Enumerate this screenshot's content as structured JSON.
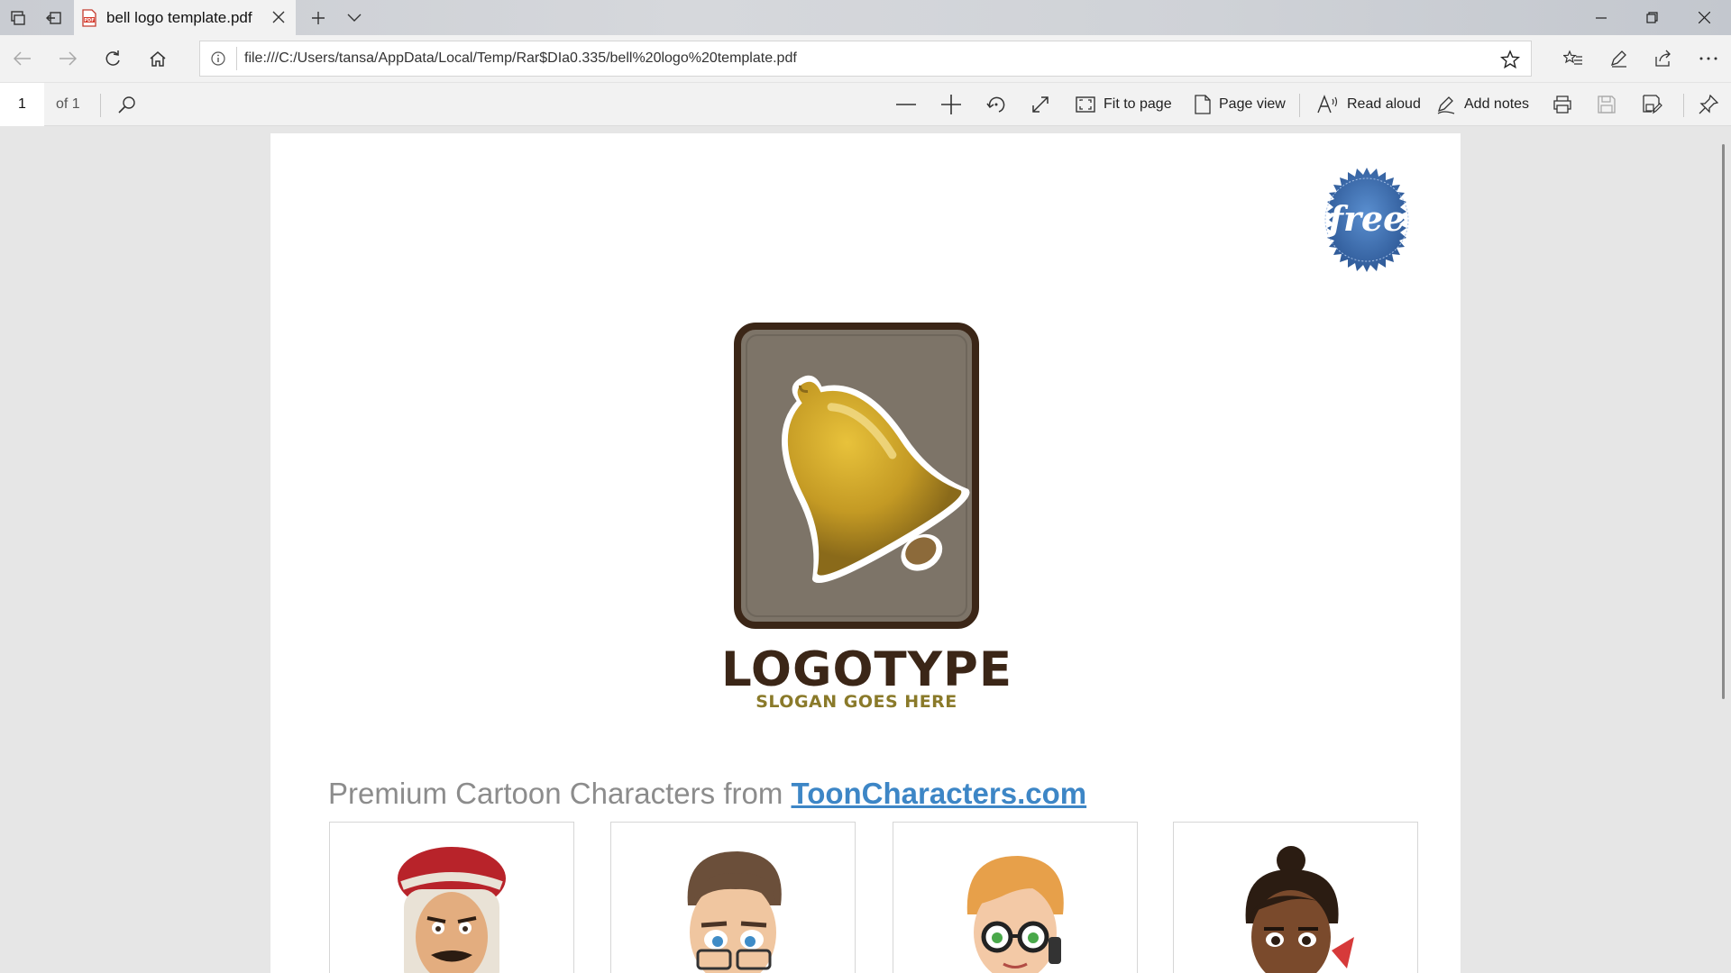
{
  "tab": {
    "title": "bell logo template.pdf",
    "pdf_badge": "PDF"
  },
  "address_bar": {
    "url": "file:///C:/Users/tansa/AppData/Local/Temp/Rar$DIa0.335/bell%20logo%20template.pdf"
  },
  "pdf_toolbar": {
    "page_number": "1",
    "page_total": "of 1",
    "fit_to_page": "Fit to page",
    "page_view": "Page view",
    "read_aloud": "Read aloud",
    "add_notes": "Add notes"
  },
  "document": {
    "badge_text": "free",
    "logotype": "LOGOTYPE",
    "slogan": "SLOGAN GOES HERE",
    "promo_text": "Premium Cartoon Characters from ",
    "promo_link": "ToonCharacters.com",
    "characters": [
      "arab-man-character",
      "glasses-man-character",
      "redhead-woman-character",
      "dark-skin-woman-character"
    ]
  },
  "colors": {
    "logo_frame": "#3b2617",
    "logo_bg": "#7d7468",
    "bell_gold": "#c9a227",
    "link": "#3d86c6",
    "badge_blue": "#3f6fb0"
  }
}
